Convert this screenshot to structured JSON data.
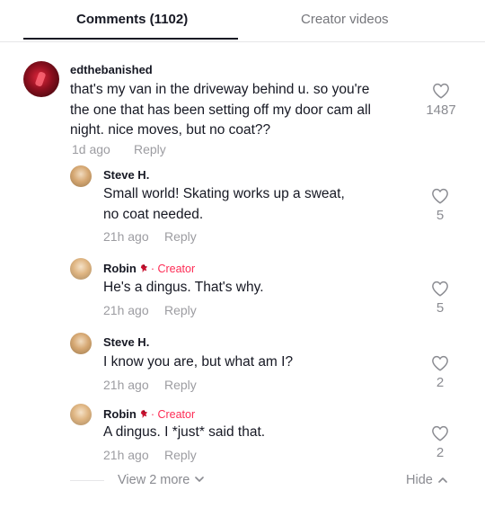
{
  "tabs": {
    "comments_label": "Comments (1102)",
    "videos_label": "Creator videos"
  },
  "main_comment": {
    "username": "edthebanished",
    "lines": [
      "that's my van in the driveway behind u. so you're",
      "the one that has been setting off my door cam all",
      "night. nice moves, but no coat??"
    ],
    "time": "1d ago",
    "reply_label": "Reply",
    "likes": "1487"
  },
  "replies": [
    {
      "username": "Steve H.",
      "creator_label": "",
      "lines": [
        "Small world! Skating works up a sweat,",
        "no coat needed."
      ],
      "time": "21h ago",
      "reply_label": "Reply",
      "likes": "5"
    },
    {
      "username": "Robin",
      "creator_label": "· Creator",
      "lines": [
        "He's a dingus. That's why."
      ],
      "time": "21h ago",
      "reply_label": "Reply",
      "likes": "5"
    },
    {
      "username": "Steve H.",
      "creator_label": "",
      "lines": [
        "I know you are, but what am I?"
      ],
      "time": "21h ago",
      "reply_label": "Reply",
      "likes": "2"
    },
    {
      "username": "Robin",
      "creator_label": "· Creator",
      "lines": [
        "A dingus. I *just* said that."
      ],
      "time": "21h ago",
      "reply_label": "Reply",
      "likes": "2"
    }
  ],
  "footer": {
    "view_more_label": "View 2 more",
    "hide_label": "Hide"
  },
  "icons": {
    "like": "heart-outline-icon",
    "view_more": "chevron-down-icon",
    "hide": "chevron-up-icon",
    "badge": "cardinal-bird-icon"
  },
  "colors": {
    "creator_accent": "#fe2c55",
    "muted_text": "#8a8b91"
  }
}
